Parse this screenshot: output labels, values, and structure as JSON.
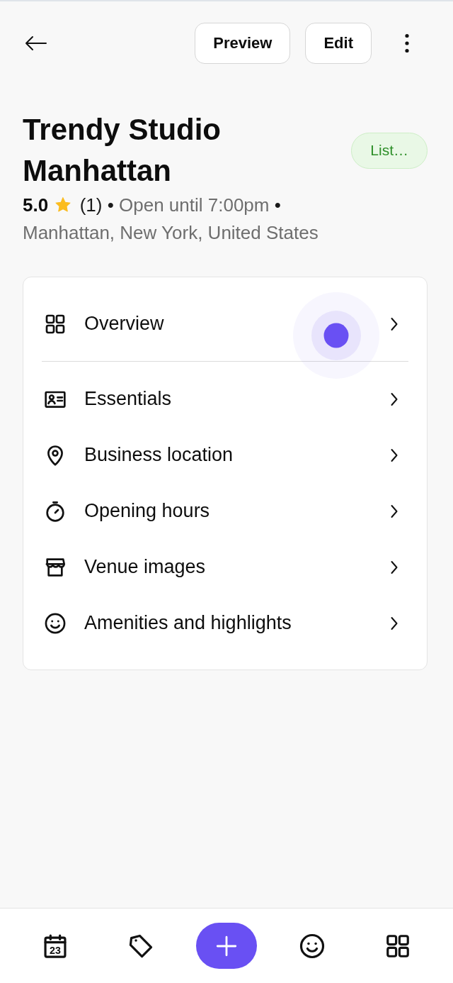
{
  "header": {
    "buttons": [
      {
        "label": "Preview"
      },
      {
        "label": "Edit"
      }
    ]
  },
  "venue": {
    "name": "Trendy Studio Manhattan",
    "status": "List…",
    "meta": [
      {
        "kind": "rating",
        "text": "5.0"
      },
      {
        "kind": "star"
      },
      {
        "kind": "count",
        "text": "(1)"
      },
      {
        "kind": "separator",
        "text": "•"
      },
      {
        "kind": "hours",
        "text": "Open until 7:00pm"
      },
      {
        "kind": "separator",
        "text": "•"
      },
      {
        "kind": "location",
        "text": "Manhattan, New York, United States"
      }
    ]
  },
  "menu": {
    "items": [
      {
        "label": "Overview",
        "kind": "grid",
        "touched": true,
        "divider": true
      },
      {
        "label": "Essentials",
        "kind": "card",
        "touched": false,
        "divider": false
      },
      {
        "label": "Business location",
        "kind": "pin",
        "touched": false,
        "divider": false
      },
      {
        "label": "Opening hours",
        "kind": "timer",
        "touched": false,
        "divider": false
      },
      {
        "label": "Venue images",
        "kind": "store",
        "touched": false,
        "divider": false
      },
      {
        "label": "Amenities and highlights",
        "kind": "smiley",
        "touched": false,
        "divider": false
      }
    ]
  },
  "bottom_nav": {
    "items": [
      {
        "kind": "calendar",
        "day": "23"
      },
      {
        "kind": "tag"
      },
      {
        "kind": "add"
      },
      {
        "kind": "smiley"
      },
      {
        "kind": "grid"
      }
    ]
  }
}
